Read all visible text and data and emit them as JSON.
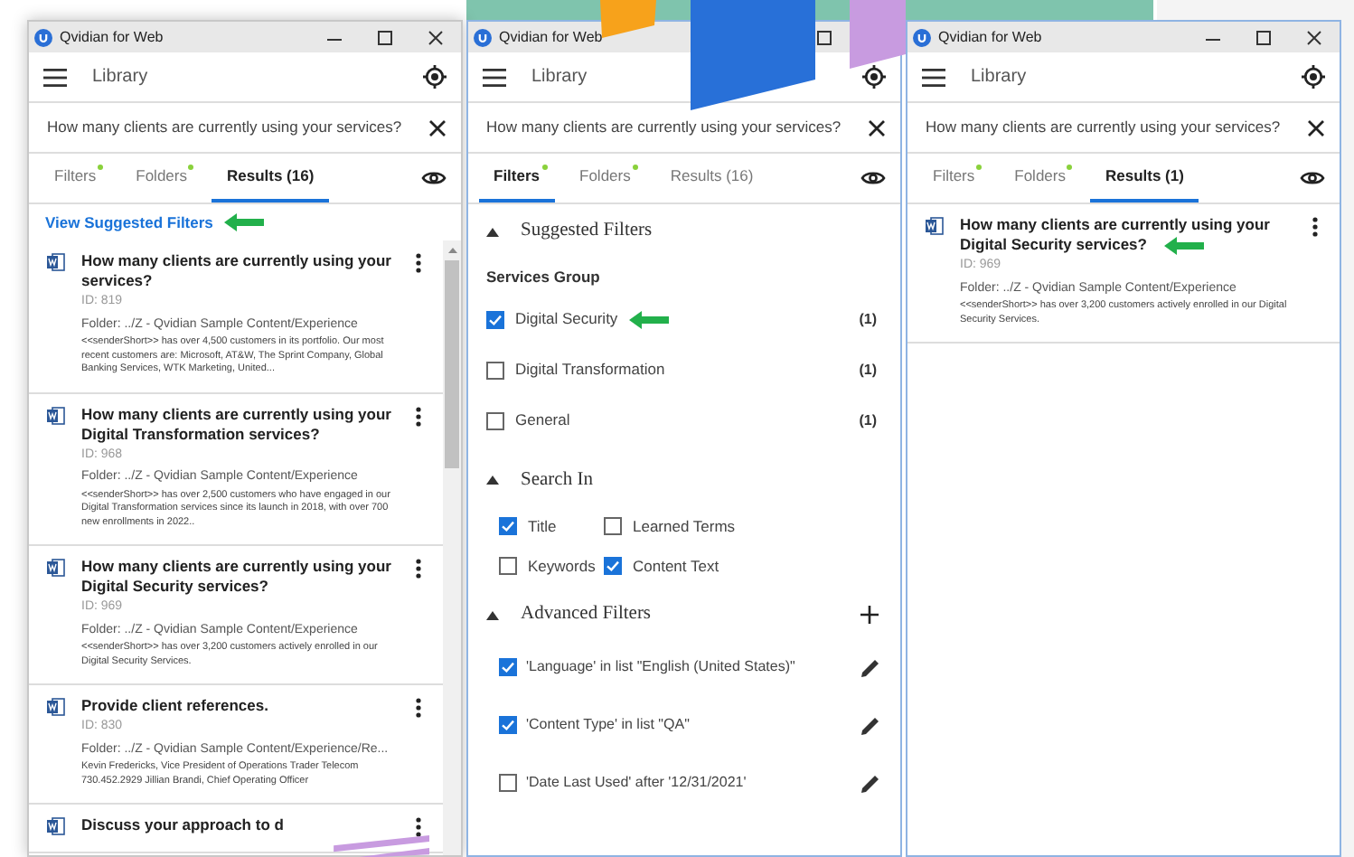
{
  "windows": [
    {
      "kind": "results",
      "title": "Qvidian for Web",
      "header": "Library",
      "query": "How many clients are currently using your services?",
      "tabs": [
        {
          "label": "Filters",
          "selected": false,
          "dot": true
        },
        {
          "label": "Folders",
          "selected": false,
          "dot": true
        },
        {
          "label": "Results (16)",
          "selected": true,
          "dot": false
        }
      ],
      "link": "View Suggested Filters",
      "link_marked": true,
      "scrollbar": true,
      "results": [
        {
          "title": "How many clients are currently using your services?",
          "id": "ID: 819",
          "folder": "Folder: ../Z - Qvidian Sample Content/Experience",
          "snippet": "<<senderShort>> has over 4,500 customers in its portfolio. Our most recent customers are: Microsoft, AT&W, The Sprint Company, Global Banking Services, WTK Marketing, United...",
          "marked": false
        },
        {
          "title": "How many clients are currently using your Digital Transformation services?",
          "id": "ID: 968",
          "folder": "Folder: ../Z - Qvidian Sample Content/Experience",
          "snippet": "<<senderShort>> has over 2,500 customers who have engaged in our Digital Transformation services since its launch in 2018, with over 700 new enrollments in 2022..",
          "marked": false
        },
        {
          "title": "How many clients are currently using your Digital Security services?",
          "id": "ID: 969",
          "folder": "Folder: ../Z - Qvidian Sample Content/Experience",
          "snippet": "<<senderShort>> has over 3,200 customers actively enrolled in our Digital Security Services.",
          "marked": false
        },
        {
          "title": "Provide client references.",
          "id": "ID: 830",
          "folder": "Folder: ../Z - Qvidian Sample Content/Experience/Re...",
          "snippet": "Kevin Fredericks, Vice President of Operations Trader Telecom 730.452.2929 Jillian Brandi, Chief Operating Officer",
          "marked": false
        },
        {
          "title": "Discuss your approach to d",
          "marked": false
        }
      ]
    },
    {
      "kind": "filters",
      "title": "Qvidian for Web",
      "header": "Library",
      "query": "How many clients are currently using your services?",
      "tabs": [
        {
          "label": "Filters",
          "selected": true,
          "dot": true
        },
        {
          "label": "Folders",
          "selected": false,
          "dot": true
        },
        {
          "label": "Results (16)",
          "selected": false,
          "dot": false
        }
      ],
      "suggested": {
        "title": "Suggested Filters",
        "expanded": true,
        "group": "Services Group",
        "options": [
          {
            "label": "Digital Security",
            "checked": true,
            "count": "(1)",
            "marked": true
          },
          {
            "label": "Digital Transformation",
            "checked": false,
            "count": "(1)",
            "marked": false
          },
          {
            "label": "General",
            "checked": false,
            "count": "(1)",
            "marked": false
          }
        ]
      },
      "search_in": {
        "title": "Search In",
        "expanded": true,
        "options": [
          {
            "label": "Title",
            "checked": true
          },
          {
            "label": "Learned Terms",
            "checked": false
          },
          {
            "label": "Keywords",
            "checked": false
          },
          {
            "label": "Content Text",
            "checked": true
          }
        ]
      },
      "advanced": {
        "title": "Advanced Filters",
        "expanded": true,
        "filters": [
          {
            "label": "'Language' in list \"English (United States)\"",
            "checked": true
          },
          {
            "label": "'Content Type' in list \"QA\"",
            "checked": true
          },
          {
            "label": "'Date Last Used' after '12/31/2021'",
            "checked": false
          }
        ]
      }
    },
    {
      "kind": "results",
      "title": "Qvidian for Web",
      "header": "Library",
      "query": "How many clients are currently using your services?",
      "tabs": [
        {
          "label": "Filters",
          "selected": false,
          "dot": true
        },
        {
          "label": "Folders",
          "selected": false,
          "dot": true
        },
        {
          "label": "Results (1)",
          "selected": true,
          "dot": false
        }
      ],
      "scrollbar": false,
      "results": [
        {
          "title": "How many clients are currently using your Digital Security services?",
          "id": "ID: 969",
          "folder": "Folder: ../Z - Qvidian Sample Content/Experience",
          "snippet": "<<senderShort>> has over 3,200 customers actively enrolled in our Digital Security Services.",
          "marked": true
        }
      ]
    }
  ]
}
